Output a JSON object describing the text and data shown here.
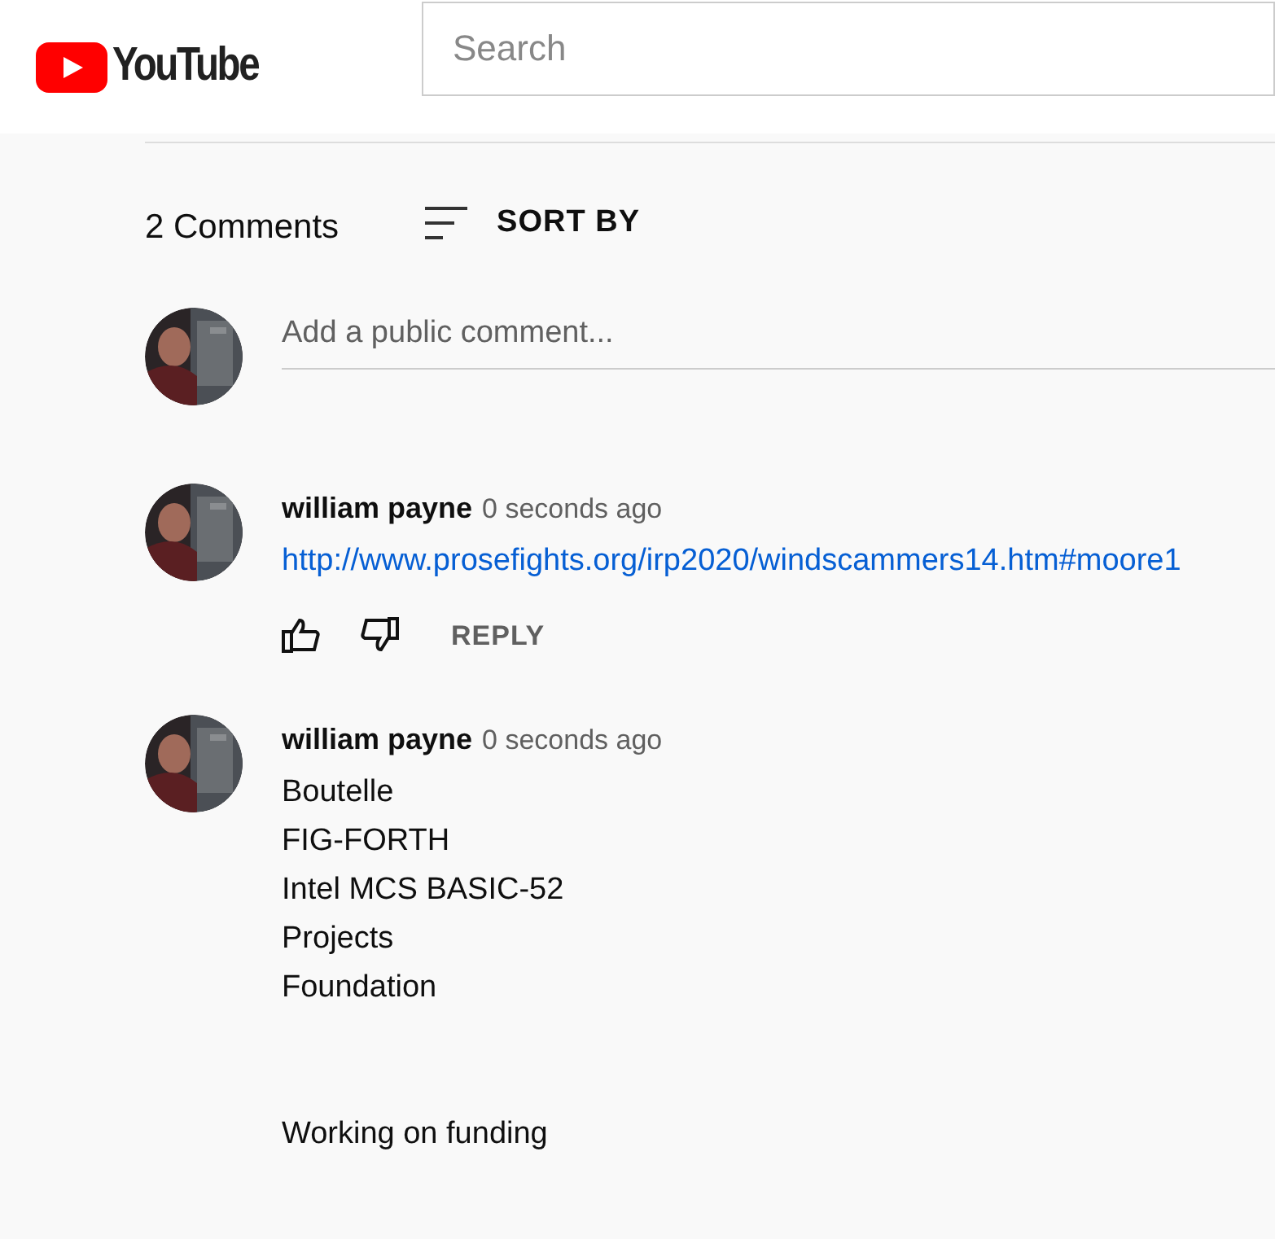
{
  "header": {
    "logo": "YouTube",
    "search": {
      "placeholder": "Search"
    }
  },
  "comments_header": {
    "count": "2 Comments",
    "sort": "SORT BY"
  },
  "add_comment": {
    "placeholder": "Add a public comment..."
  },
  "comments": [
    {
      "author": "william payne",
      "time": "0 seconds ago",
      "kind": "link",
      "body": [
        [
          "http://www.prosefights.org/irp2020/windscammers14.htm#moore1"
        ]
      ],
      "actions": {
        "reply": "REPLY"
      }
    },
    {
      "author": "william payne",
      "time": "0 seconds ago",
      "kind": "text",
      "body": [
        [
          "Boutelle",
          "FIG-FORTH",
          "Intel MCS BASIC-52",
          "Projects",
          "Foundation"
        ],
        [
          "Working on funding"
        ]
      ]
    }
  ]
}
